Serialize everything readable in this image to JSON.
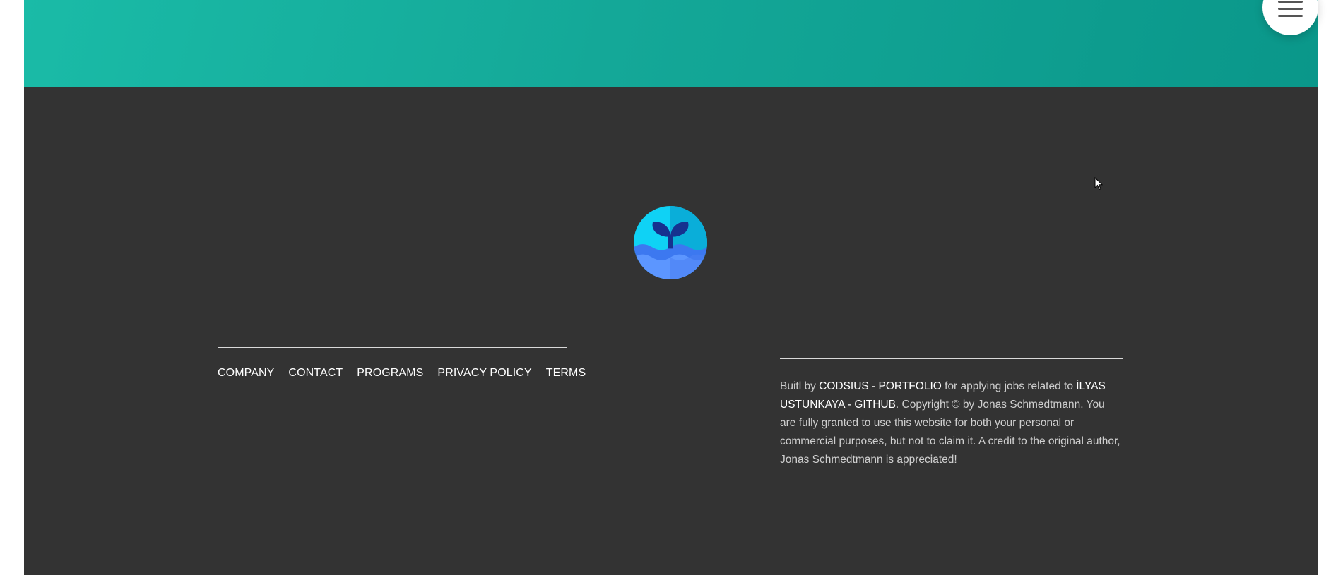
{
  "footer": {
    "nav": [
      "COMPANY",
      "CONTACT",
      "PROGRAMS",
      "PRIVACY POLICY",
      "TERMS"
    ],
    "copyright": {
      "prefix": "Buitl by ",
      "link1": "CODSIUS - PORTFOLIO",
      "middle": " for applying jobs related to ",
      "link2": "İLYAS USTUNKAYA - GITHUB",
      "suffix": ". Copyright © by Jonas Schmedtmann. You are fully granted to use this website for both your personal or commercial purposes, but not to claim it. A credit to the original author, Jonas Schmedtmann is appreciated!"
    }
  },
  "icons": {
    "logo": "whale-tail-logo-icon",
    "menu": "hamburger-menu-icon",
    "cursor": "mouse-cursor-icon"
  },
  "colors": {
    "hero_gradient_start": "#1abba7",
    "hero_gradient_end": "#0a978a",
    "footer_background": "#333333",
    "logo_sky": "#0fd2f5",
    "logo_tail": "#16318f",
    "logo_wave": "#4d86ff"
  }
}
